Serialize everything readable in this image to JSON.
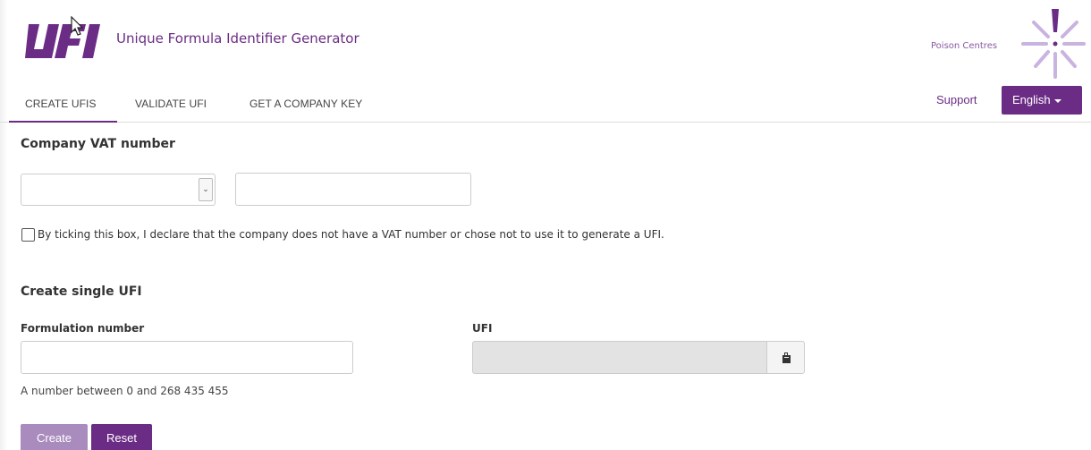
{
  "header": {
    "app_title": "Unique Formula Identifier Generator",
    "partner_link": "Poison Centres",
    "logo_text": "UFI"
  },
  "nav": {
    "tabs": [
      {
        "label": "CREATE UFIS",
        "active": true
      },
      {
        "label": "VALIDATE UFI",
        "active": false
      },
      {
        "label": "GET A COMPANY KEY",
        "active": false
      }
    ],
    "support_label": "Support",
    "language_label": "English"
  },
  "vat_section": {
    "heading": "Company VAT number",
    "country_select_value": "",
    "vat_input_value": "",
    "no_vat_checkbox_checked": false,
    "no_vat_checkbox_label": "By ticking this box, I declare that the company does not have a VAT number or chose not to use it to generate a UFI."
  },
  "single_ufi": {
    "heading": "Create single UFI",
    "formulation_label": "Formulation number",
    "formulation_value": "",
    "formulation_helper": "A number between 0 and 268 435 455",
    "ufi_label": "UFI",
    "ufi_value": "",
    "create_label": "Create",
    "reset_label": "Reset"
  },
  "colors": {
    "brand_purple": "#6b2c85",
    "disabled_purple": "#a98bbd",
    "icon_lavender": "#c9b3e0"
  }
}
